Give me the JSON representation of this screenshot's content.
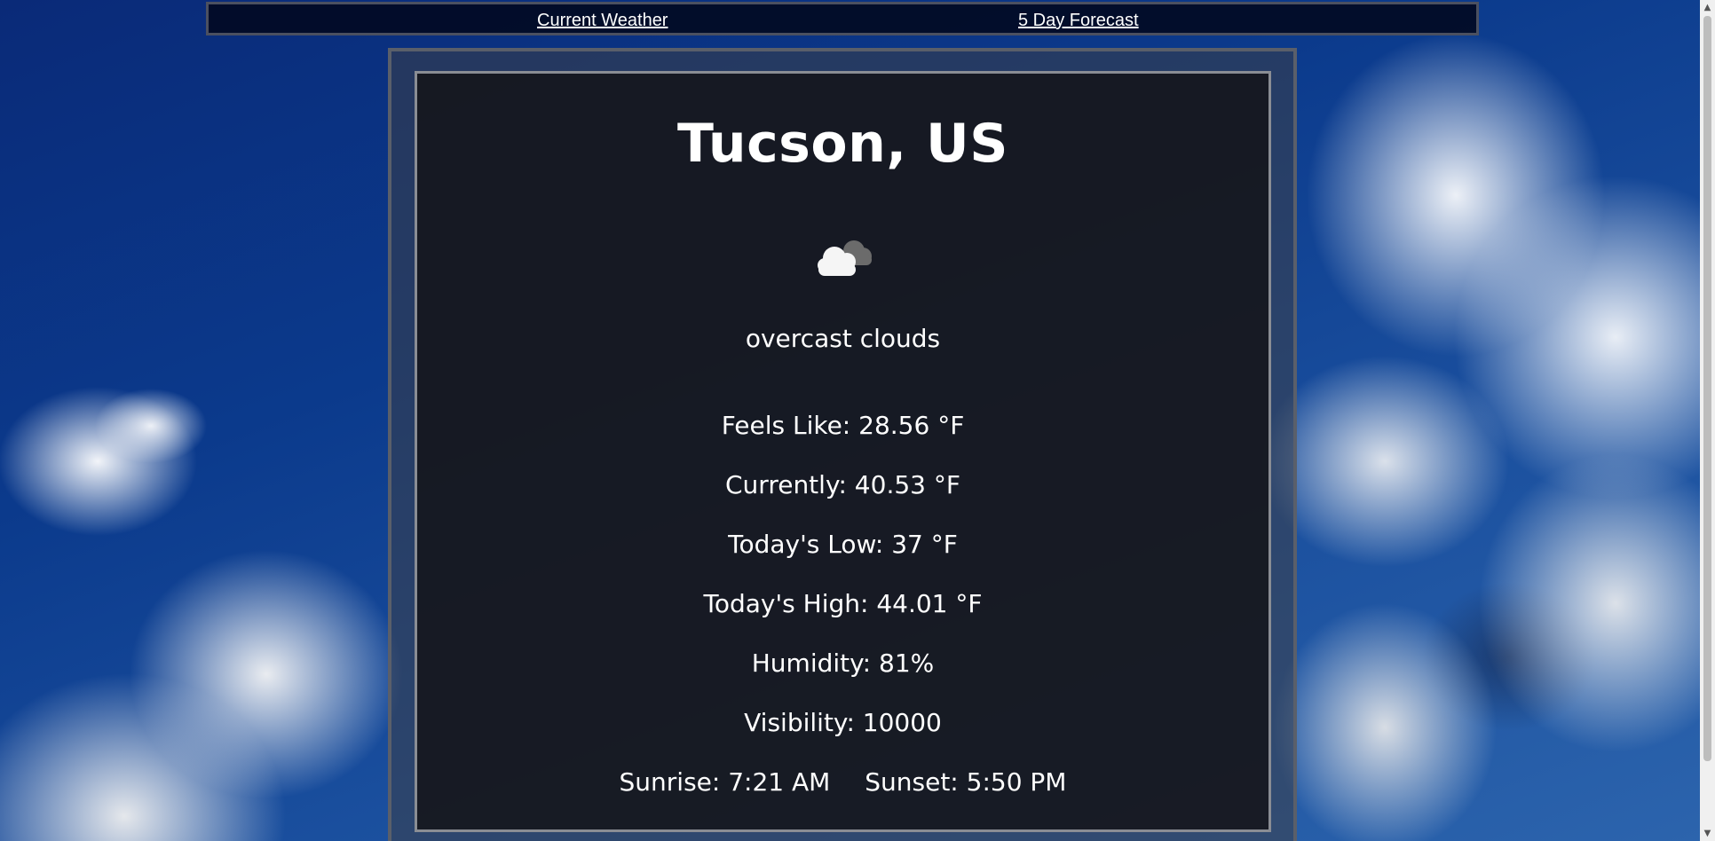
{
  "nav": {
    "current_label": "Current Weather",
    "forecast_label": "5 Day Forecast"
  },
  "weather": {
    "city": "Tucson, US",
    "icon": "overcast-clouds-icon",
    "description": "overcast clouds",
    "feels_like": "Feels Like: 28.56 °F",
    "currently": "Currently: 40.53 °F",
    "low": "Today's Low: 37 °F",
    "high": "Today's High: 44.01 °F",
    "humidity": "Humidity: 81%",
    "visibility": "Visibility: 10000",
    "sunrise": "Sunrise: 7:21 AM",
    "sunset": "Sunset: 5:50 PM"
  },
  "scrollbar": {
    "up_icon": "▲",
    "down_icon": "▼"
  },
  "colors": {
    "panel_bg": "#141418",
    "nav_bg": "#020a23",
    "text": "#ffffff"
  }
}
